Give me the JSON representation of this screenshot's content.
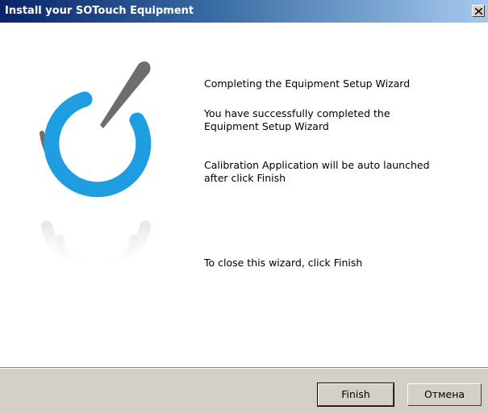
{
  "window": {
    "title": "Install your SOTouch Equipment"
  },
  "wizard": {
    "heading": "Completing the Equipment Setup Wizard",
    "success_line1": "You have successfully completed the",
    "success_line2": "Equipment Setup Wizard",
    "calib_line1": "Calibration Application will be auto launched",
    "calib_line2": "after click Finish",
    "close_hint": "To close this wizard, click Finish"
  },
  "footer": {
    "finish_label": "Finish",
    "cancel_label": "Отмена"
  },
  "colors": {
    "title_bar_start": "#0a246a",
    "title_bar_end": "#a6caf0",
    "logo_blue": "#1e9ee0",
    "logo_gray": "#6d6d6d",
    "button_face": "#d4d0c8"
  },
  "icons": {
    "close": "close-icon",
    "logo": "sotouch-logo"
  }
}
